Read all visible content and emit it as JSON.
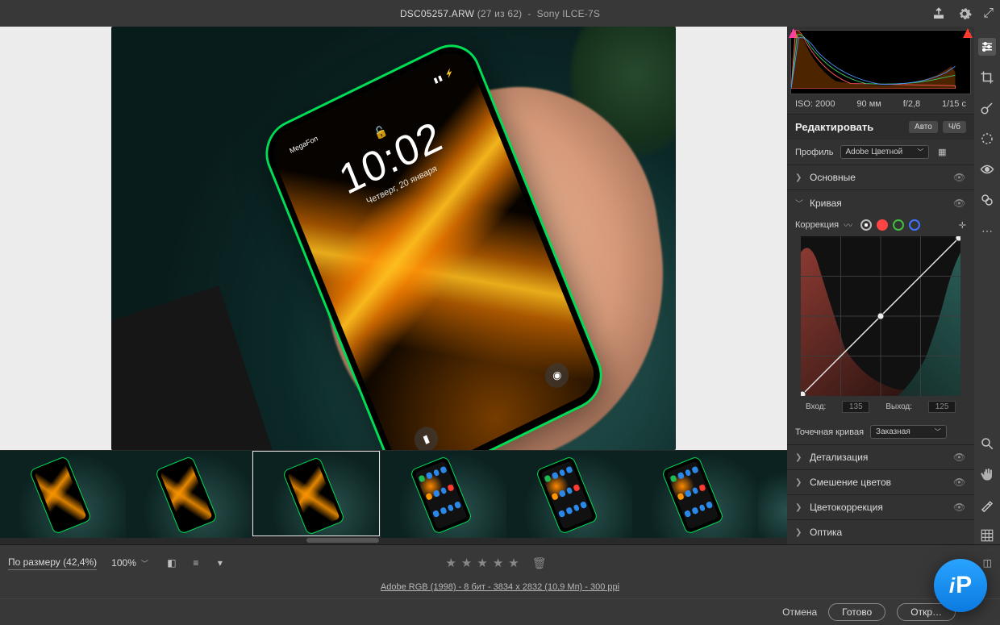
{
  "titlebar": {
    "filename": "DSC05257.ARW",
    "index": "(27 из 62)",
    "camera": "Sony ILCE-7S"
  },
  "phone": {
    "carrier": "MegaFon",
    "time": "10:02",
    "date": "Четверг, 20 января"
  },
  "bottombar": {
    "fit_label": "По размеру (42,4%)",
    "zoom": "100%"
  },
  "meta_line": "Adobe RGB (1998) - 8 бит - 3834 x 2832 (10,9 Мп) - 300 ppi",
  "footer": {
    "cancel": "Отмена",
    "done": "Готово",
    "open": "Откр…"
  },
  "metadata": {
    "iso": "ISO: 2000",
    "focal": "90 мм",
    "fstop": "f/2,8",
    "shutter": "1/15 с"
  },
  "edit": {
    "title": "Редактировать",
    "auto": "Авто",
    "bw": "Ч/б"
  },
  "profile": {
    "label": "Профиль",
    "value": "Adobe Цветной"
  },
  "sections": {
    "basic": "Основные",
    "curve": "Кривая",
    "detail": "Детализация",
    "color_mix": "Смешение цветов",
    "color_grading": "Цветокоррекция",
    "optics": "Оптика"
  },
  "curve": {
    "correction": "Коррекция",
    "in_label": "Вход:",
    "out_label": "Выход:",
    "in_val": "135",
    "out_val": "125",
    "point_label": "Точечная кривая",
    "point_value": "Заказная"
  }
}
